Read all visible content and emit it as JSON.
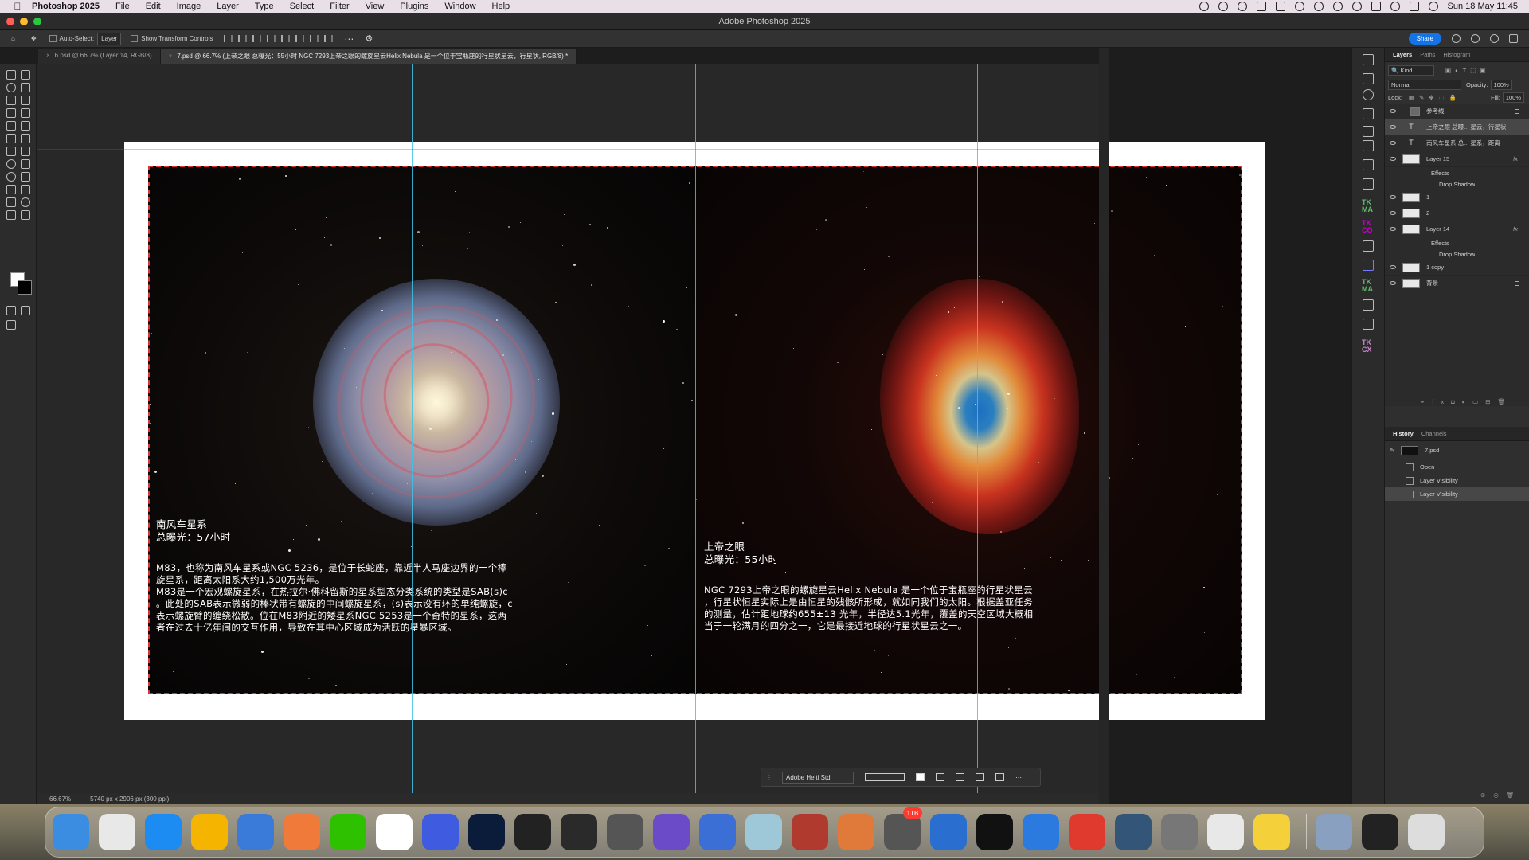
{
  "menubar": {
    "app_name": "Photoshop 2025",
    "items": [
      "File",
      "Edit",
      "Image",
      "Layer",
      "Type",
      "Select",
      "Filter",
      "View",
      "Plugins",
      "Window",
      "Help"
    ],
    "clock": "Sun 18 May  11:45"
  },
  "window": {
    "title": "Adobe Photoshop 2025"
  },
  "options_bar": {
    "auto_select_label": "Auto-Select:",
    "auto_select_value": "Layer",
    "show_transform_label": "Show Transform Controls",
    "share_label": "Share"
  },
  "doc_tabs": [
    {
      "label": "6.psd @ 66.7% (Layer 14, RGB/8)"
    },
    {
      "label": "7.psd @ 66.7% (上帝之眼 总曝光：55小时  NGC 7293上帝之眼的螺旋星云Helix Nebula 是一个位于宝瓶座的行星状星云，行星状, RGB/8) *"
    }
  ],
  "canvas": {
    "left_caption": {
      "title": "南风车星系\n总曝光：57小时",
      "body": "M83，也称为南风车星系或NGC 5236，是位于长蛇座，靠近半人马座边界的一个棒\n旋星系，距离太阳系大约1,500万光年。\nM83是一个宏观螺旋星系，在热拉尔·佛科留斯的星系型态分类系统的类型是SAB(s)c\n。此处的SAB表示微弱的棒状带有螺旋的中间螺旋星系，(s)表示没有环的单纯螺旋，c\n表示螺旋臂的缠绕松散。位在M83附近的矮星系NGC 5253是一个奇特的星系，这两\n者在过去十亿年间的交互作用，导致在其中心区域成为活跃的星暴区域。"
    },
    "right_caption": {
      "title": "上帝之眼\n总曝光：55小时",
      "body": "NGC 7293上帝之眼的螺旋星云Helix Nebula 是一个位于宝瓶座的行星状星云\n，行星状恒星实际上是由恒星的残骸所形成，就如同我们的太阳。根据盖亚任务\n的测量，估计距地球约655±13 光年，半径达5.1光年，覆盖的天空区域大概相\n当于一轮满月的四分之一，它是最接近地球的行星状星云之一。"
    }
  },
  "type_toolbar": {
    "font": "Adobe Heiti Std"
  },
  "status_bar": {
    "zoom": "66.67%",
    "doc_info": "5740 px x 2906 px (300 ppi)"
  },
  "layers_panel": {
    "tabs": [
      "Layers",
      "Paths",
      "Histogram"
    ],
    "filter": "Kind",
    "blend_mode": "Normal",
    "opacity_label": "Opacity:",
    "opacity": "100%",
    "lock_label": "Lock:",
    "fill_label": "Fill:",
    "fill": "100%",
    "layers": [
      {
        "name": "参考线",
        "kind": "folder"
      },
      {
        "name": "上帝之眼 总曝... 星云，行星状",
        "kind": "text",
        "selected": true
      },
      {
        "name": "南风车星系 总... 星系，距离",
        "kind": "text"
      },
      {
        "name": "Layer 15",
        "kind": "pixel",
        "fx": "fx"
      },
      {
        "name": "Effects",
        "kind": "sub"
      },
      {
        "name": "Drop Shadow",
        "kind": "sub2"
      },
      {
        "name": "1",
        "kind": "pixel"
      },
      {
        "name": "2",
        "kind": "pixel"
      },
      {
        "name": "Layer 14",
        "kind": "pixel",
        "fx": "fx"
      },
      {
        "name": "Effects",
        "kind": "sub"
      },
      {
        "name": "Drop Shadow",
        "kind": "sub2"
      },
      {
        "name": "1 copy",
        "kind": "pixel"
      },
      {
        "name": "背景",
        "kind": "pixel"
      }
    ]
  },
  "history_panel": {
    "tabs": [
      "History",
      "Channels"
    ],
    "snapshot": "7.psd",
    "items": [
      "Open",
      "Layer Visibility",
      "Layer Visibility"
    ]
  },
  "dock": {
    "badge_tb": "1TB",
    "apps": [
      "Finder",
      "Launchpad",
      "App Store",
      "Pages",
      "Dictionary",
      "Notion",
      "WeChat",
      "Chrome",
      "Linear",
      "Photoshop",
      "Final Cut Pro",
      "DaVinci Resolve",
      "LRTimelapse",
      "Affinity",
      "Weather",
      "Preview",
      "PhotoBooth",
      "Pins",
      "Screenshot",
      "Framer",
      "Terminal",
      "Cloud",
      "WPS",
      "QuickTime",
      "System Settings",
      "Folder",
      "Tips",
      "Preview2",
      "Document",
      "Trash"
    ]
  }
}
